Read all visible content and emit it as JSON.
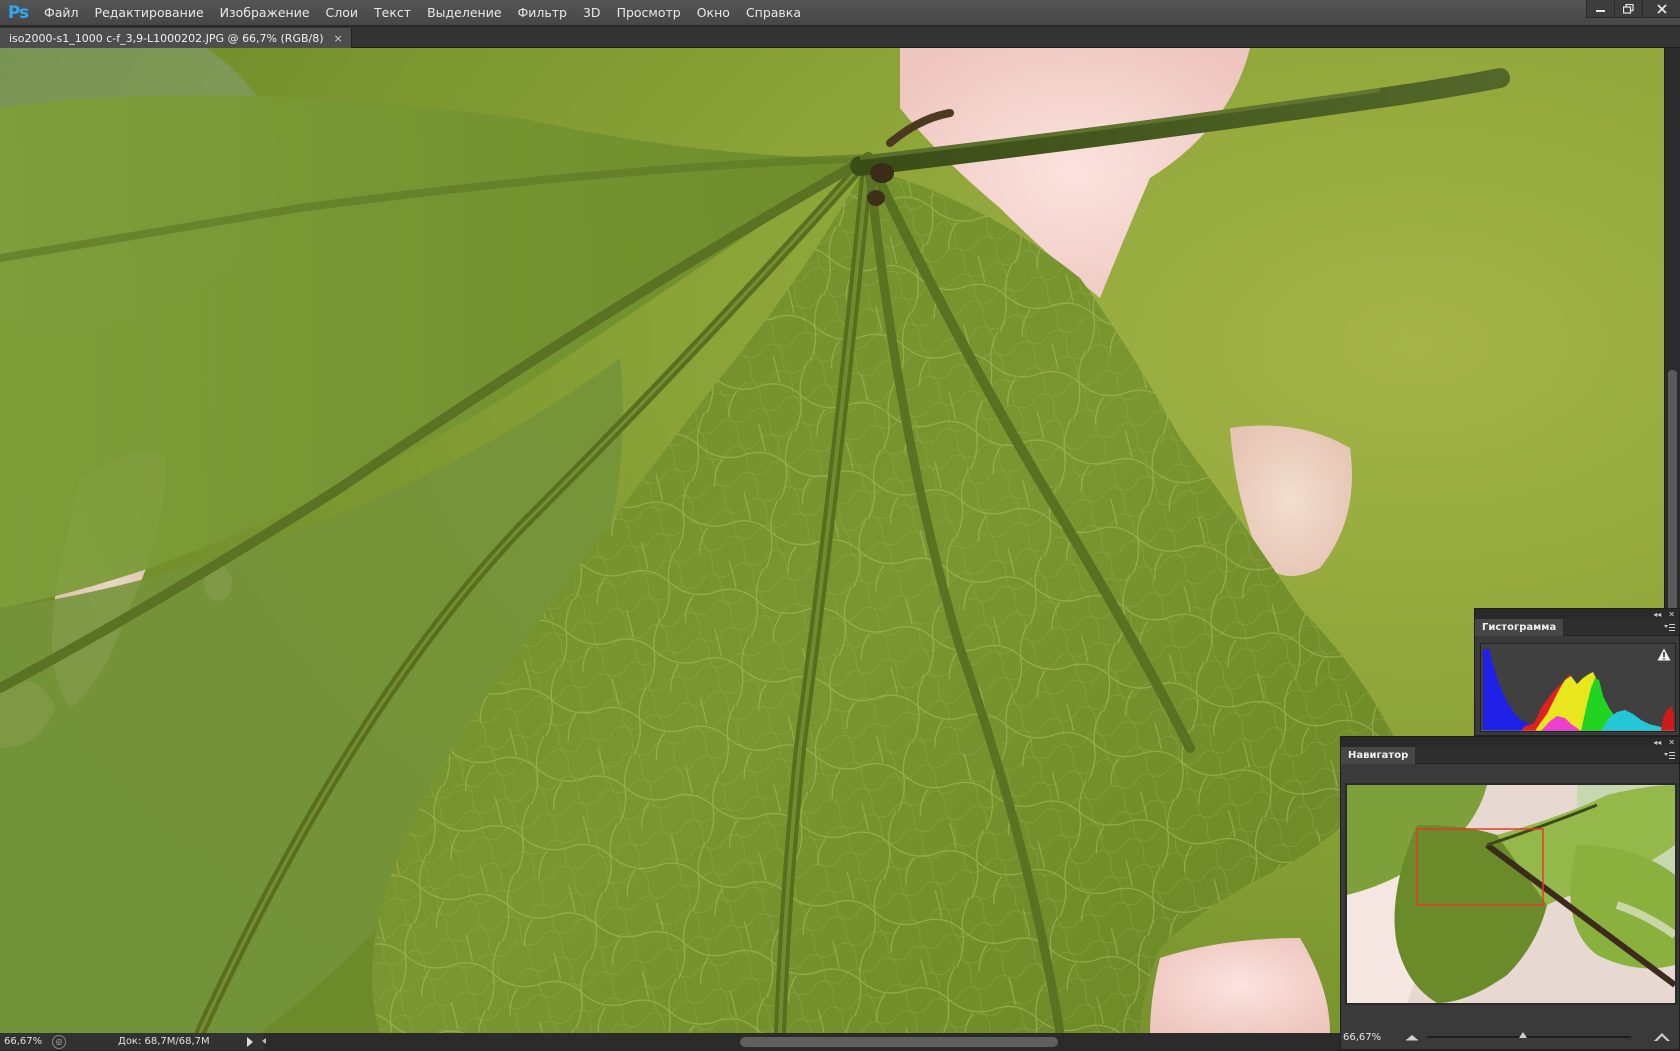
{
  "app": {
    "logo": "Ps"
  },
  "menu": {
    "items": [
      "Файл",
      "Редактирование",
      "Изображение",
      "Слои",
      "Текст",
      "Выделение",
      "Фильтр",
      "3D",
      "Просмотр",
      "Окно",
      "Справка"
    ]
  },
  "document_tab": {
    "title": "iso2000-s1_1000 c-f_3,9-L1000202.JPG @ 66,7% (RGB/8)",
    "close": "×"
  },
  "status_bar": {
    "zoom": "66,67%",
    "doc_size": "Док: 68,7M/68,7M"
  },
  "histogram_panel": {
    "tab_label": "Гистограмма",
    "warning_icon": "warning-triangle-icon"
  },
  "navigator_panel": {
    "tab_label": "Навигатор",
    "zoom": "66,67%",
    "zoom_level_fraction": 0.47
  },
  "colors": {
    "chrome_dark": "#282828",
    "panel_bg": "#3a3a3a",
    "ps_blue": "#2fa7f2",
    "nav_view_box": "#e23a2c",
    "leaf_green": "#6c8a2a"
  }
}
